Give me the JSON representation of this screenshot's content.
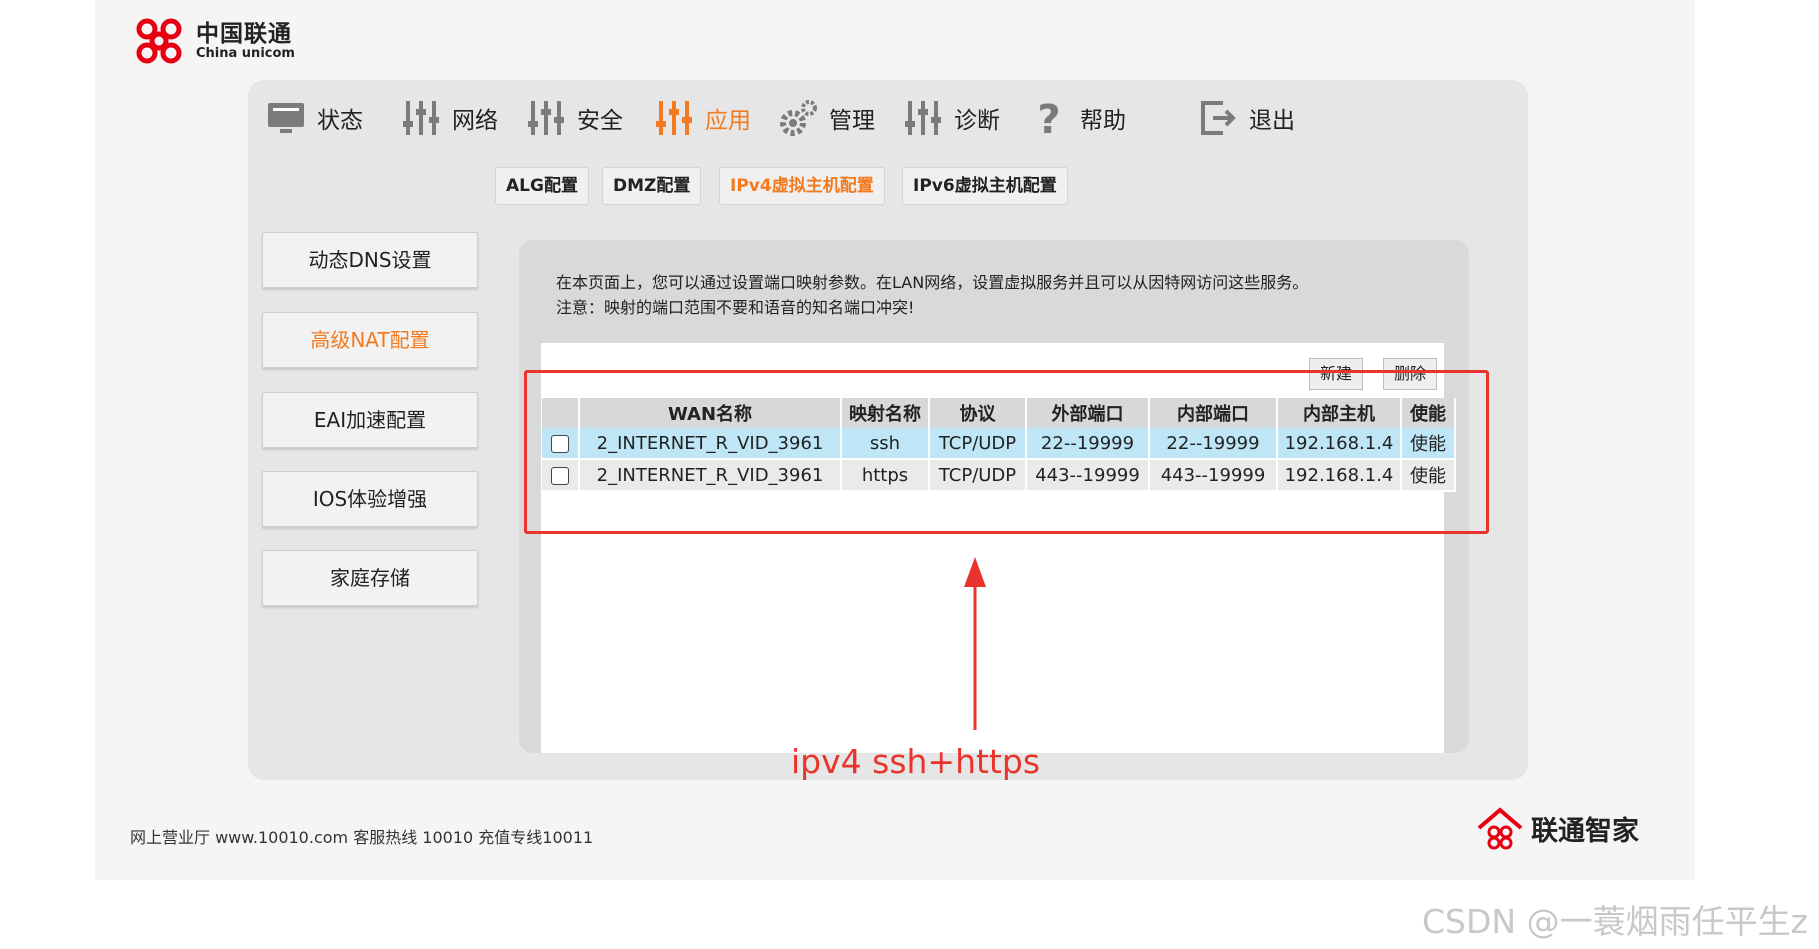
{
  "logo": {
    "cn": "中国联通",
    "en": "China unicom"
  },
  "nav": [
    {
      "label": "状态",
      "icon": "monitor-icon"
    },
    {
      "label": "网络",
      "icon": "sliders-icon"
    },
    {
      "label": "安全",
      "icon": "sliders-icon"
    },
    {
      "label": "应用",
      "icon": "sliders-icon",
      "active": true
    },
    {
      "label": "管理",
      "icon": "gear-icon"
    },
    {
      "label": "诊断",
      "icon": "sliders-icon"
    },
    {
      "label": "帮助",
      "icon": "question-icon"
    },
    {
      "label": "退出",
      "icon": "logout-icon"
    }
  ],
  "subtabs": [
    {
      "label": "ALG配置"
    },
    {
      "label": "DMZ配置"
    },
    {
      "label": "IPv4虚拟主机配置",
      "active": true
    },
    {
      "label": "IPv6虚拟主机配置"
    }
  ],
  "sidebar": [
    {
      "label": "动态DNS设置"
    },
    {
      "label": "高级NAT配置",
      "active": true
    },
    {
      "label": "EAI加速配置"
    },
    {
      "label": "IOS体验增强"
    },
    {
      "label": "家庭存储"
    }
  ],
  "description": {
    "line1": "在本页面上，您可以通过设置端口映射参数。在LAN网络，设置虚拟服务并且可以从因特网访问这些服务。",
    "line2": "注意：映射的端口范围不要和语音的知名端口冲突!"
  },
  "actions": {
    "new": "新建",
    "delete": "删除"
  },
  "table": {
    "headers": [
      "",
      "WAN名称",
      "映射名称",
      "协议",
      "外部端口",
      "内部端口",
      "内部主机",
      "使能"
    ],
    "rows": [
      {
        "wan": "2_INTERNET_R_VID_3961",
        "mapping": "ssh",
        "protocol": "TCP/UDP",
        "ext_port": "22--19999",
        "int_port": "22--19999",
        "host": "192.168.1.4",
        "enable": "使能",
        "checked": false
      },
      {
        "wan": "2_INTERNET_R_VID_3961",
        "mapping": "https",
        "protocol": "TCP/UDP",
        "ext_port": "443--19999",
        "int_port": "443--19999",
        "host": "192.168.1.4",
        "enable": "使能",
        "checked": false
      }
    ]
  },
  "annotation": {
    "text": "ipv4 ssh+https",
    "color": "#e8342c"
  },
  "footer": "网上营业厅 www.10010.com  客服热线  10010  充值专线10011",
  "brand": "联通智家",
  "watermark": "CSDN @一蓑烟雨任平生z",
  "colors": {
    "accent": "#f47a20",
    "row_highlight": "#bfe6f7",
    "annotation": "#e8342c"
  }
}
